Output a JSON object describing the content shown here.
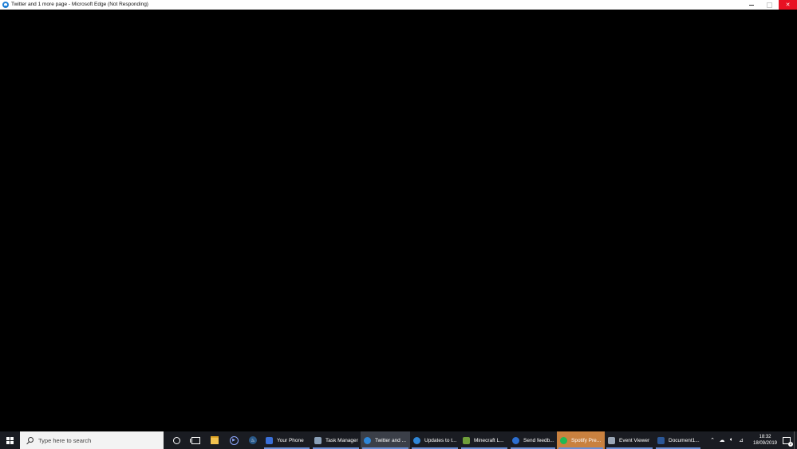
{
  "window": {
    "title": "Twitter and 1 more page - Microsoft Edge (Not Responding)"
  },
  "taskbar": {
    "search_placeholder": "Type here to search",
    "apps": [
      {
        "label": "Your Phone",
        "icon": "your-phone-icon",
        "color": "#3a6fd8"
      },
      {
        "label": "Task Manager",
        "icon": "task-manager-icon",
        "color": "#8aa0b8"
      },
      {
        "label": "Twitter and ...",
        "icon": "edge-icon",
        "color": "#2f87d8"
      },
      {
        "label": "Updates to t...",
        "icon": "edge-icon",
        "color": "#2f87d8"
      },
      {
        "label": "Minecraft L...",
        "icon": "minecraft-icon",
        "color": "#6f9e3a"
      },
      {
        "label": "Send feedb...",
        "icon": "feedback-hub-icon",
        "color": "#2c6fd1"
      },
      {
        "label": "Spotify Pre...",
        "icon": "spotify-icon",
        "color": "#1db954"
      },
      {
        "label": "Event Viewer",
        "icon": "event-viewer-icon",
        "color": "#9aa6b5"
      },
      {
        "label": "Document1...",
        "icon": "word-icon",
        "color": "#2b5797"
      }
    ],
    "clock": {
      "time": "18:32",
      "date": "18/09/2019"
    },
    "notification_count": "2"
  }
}
